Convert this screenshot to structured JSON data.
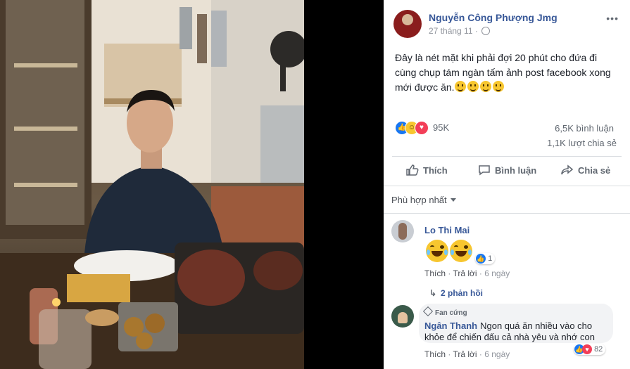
{
  "post": {
    "author": "Nguyễn Công Phượng Jmg",
    "date": "27 tháng 11 ·",
    "more": "•••",
    "text": "Đây là nét mặt khi phải đợi 20 phút cho đứa đi cùng chụp tám ngàn tấm ảnh post facebook xong mới được ăn.",
    "emoji_count": 4
  },
  "stats": {
    "reaction_count": "95K",
    "comments": "6,5K bình luận",
    "shares": "1,1K lượt chia sẻ"
  },
  "actions": {
    "like": "Thích",
    "comment": "Bình luận",
    "share": "Chia sẻ"
  },
  "sort": {
    "label": "Phù hợp nhất"
  },
  "comments": [
    {
      "name": "Lo Thi Mai",
      "reaction_count": "1",
      "like": "Thích",
      "reply": "Trả lời",
      "time": "6 ngày",
      "replies": "2 phản hồi"
    },
    {
      "badge": "Fan cứng",
      "name": "Ngân Thanh",
      "text": "Ngon quá ăn nhiều vào cho khỏe để chiến đấu cả nhà yêu và nhớ con",
      "reaction_count": "82",
      "like": "Thích",
      "reply": "Trả lời",
      "time": "6 ngày"
    }
  ],
  "colors": {
    "link": "#385898",
    "like_blue": "#1877f2",
    "love_red": "#f33e58",
    "haha_yellow": "#f7c62f"
  }
}
